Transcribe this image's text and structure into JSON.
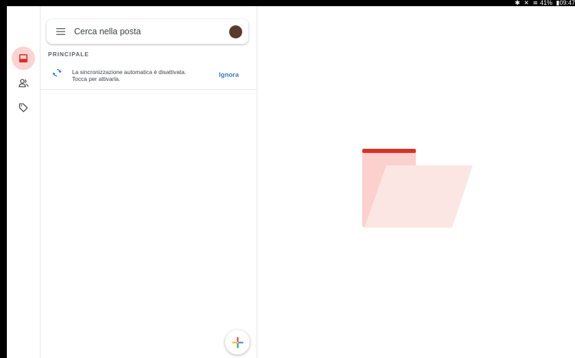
{
  "status_bar": {
    "warning_icon": "warning-triangle-icon",
    "icons": [
      "bluetooth-icon",
      "mute-icon",
      "wifi-icon"
    ],
    "battery": "41%",
    "battery_icon": "battery-icon",
    "time": "09:47"
  },
  "rail": {
    "items": [
      {
        "name": "inbox",
        "icon": "inbox-icon",
        "active": true
      },
      {
        "name": "contacts",
        "icon": "people-icon",
        "active": false
      },
      {
        "name": "labels",
        "icon": "label-tag-icon",
        "active": false
      }
    ]
  },
  "search": {
    "placeholder": "Cerca nella posta",
    "menu_icon": "hamburger-menu-icon",
    "avatar": "account-avatar"
  },
  "list": {
    "section_label": "PRINCIPALE",
    "sync_notice": {
      "icon": "sync-icon",
      "line1": "La sincronizzazione automatica è disattivata.",
      "line2": "Tocca per attivarla.",
      "action": "Ignora"
    }
  },
  "fab": {
    "icon": "compose-plus-icon"
  },
  "empty_state": {
    "illustration": "empty-folder-illustration"
  },
  "colors": {
    "accent_red": "#d93025",
    "rail_active_bg": "#fbd3d0",
    "link_blue": "#3d7abd",
    "folder_back": "#fbd0cd",
    "folder_front": "#fce6e4"
  }
}
